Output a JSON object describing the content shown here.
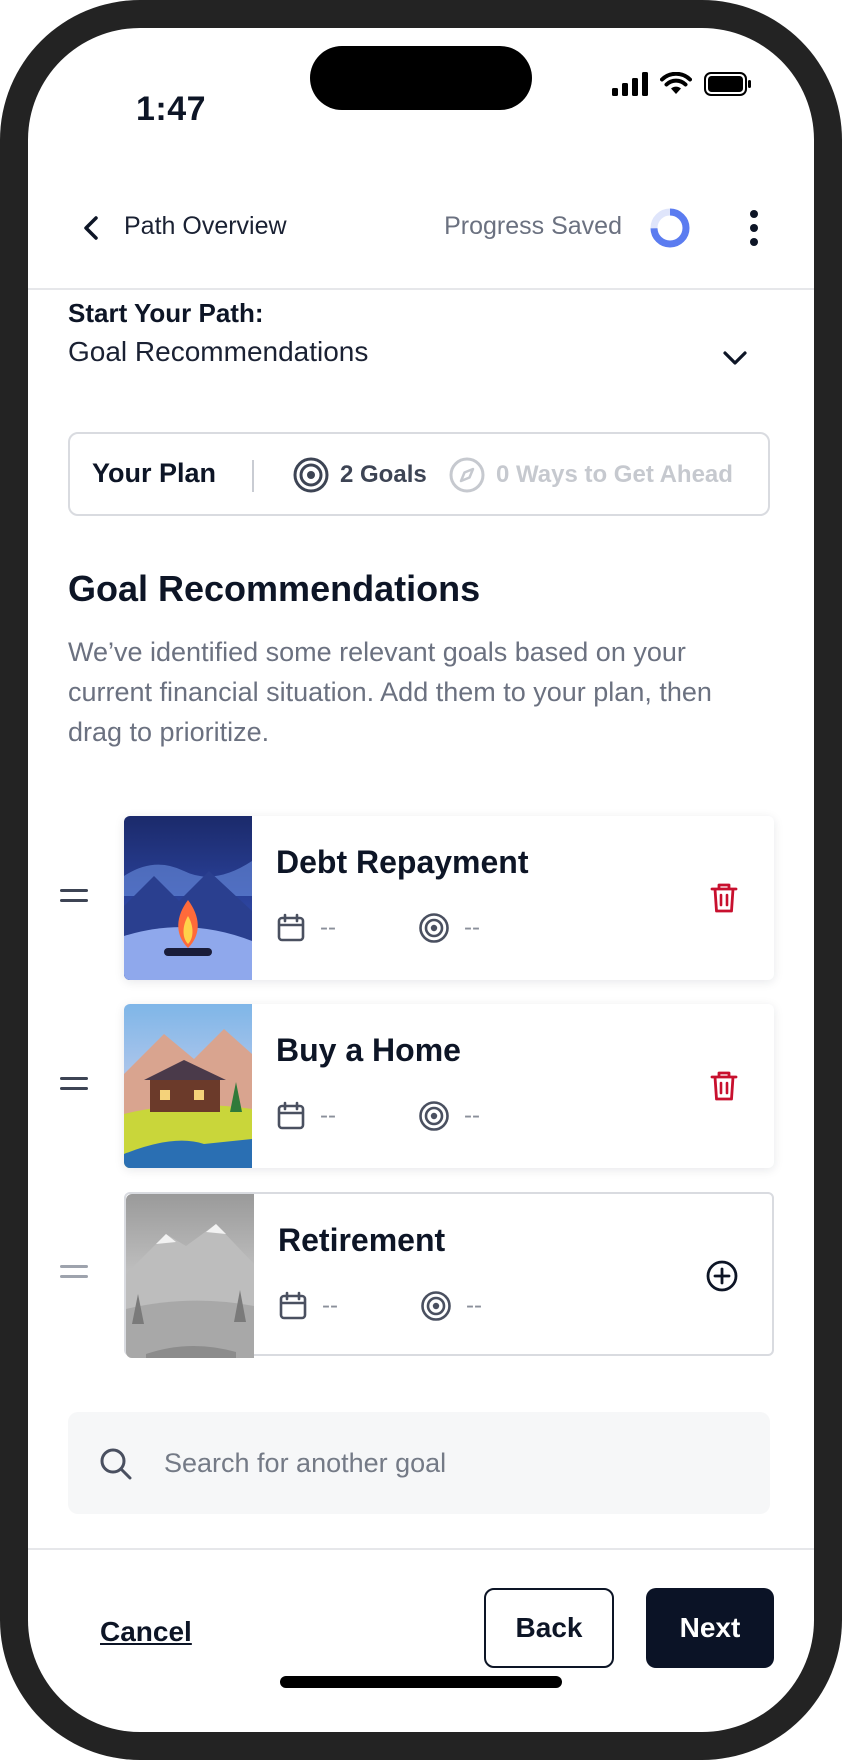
{
  "status_bar": {
    "time": "1:47"
  },
  "header": {
    "back_label": "Path Overview",
    "progress_status": "Progress Saved"
  },
  "path": {
    "label": "Start Your Path:",
    "subtitle": "Goal Recommendations"
  },
  "plan": {
    "title": "Your Plan",
    "goals": "2 Goals",
    "ways": "0 Ways to Get Ahead"
  },
  "recommendations": {
    "title": "Goal Recommendations",
    "description": "We’ve identified some relevant goals based on your current financial situation. Add them to your plan, then drag to prioritize."
  },
  "goals": [
    {
      "name": "Debt Repayment",
      "date": "--",
      "target": "--",
      "action": "delete",
      "icon": "trash-icon"
    },
    {
      "name": "Buy a Home",
      "date": "--",
      "target": "--",
      "action": "delete",
      "icon": "trash-icon"
    },
    {
      "name": "Retirement",
      "date": "--",
      "target": "--",
      "action": "add",
      "icon": "plus-circle-icon"
    }
  ],
  "search": {
    "placeholder": "Search for another goal",
    "value": ""
  },
  "footer": {
    "cancel_label": "Cancel",
    "back_label": "Back",
    "next_label": "Next"
  },
  "colors": {
    "primary": "#0b1326",
    "danger": "#c8102e",
    "progress": "#5b7cf0",
    "muted_text": "#6b7180"
  }
}
